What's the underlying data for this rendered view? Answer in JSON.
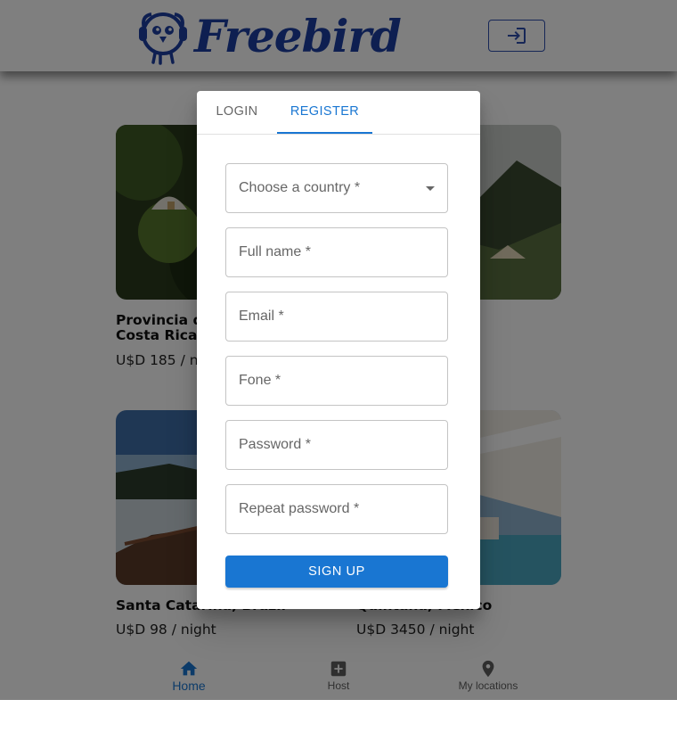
{
  "header": {
    "logo_text": "Freebird",
    "login_icon": "login-icon"
  },
  "listings": [
    {
      "title": "Provincia de Alajuela, Costa Rica",
      "price": "U$D 185 / night"
    },
    {
      "title": "",
      "price": ""
    },
    {
      "title": "Santa Catarina, Brazil",
      "price": "U$D 98 / night"
    },
    {
      "title": "Quintana, Mexico",
      "price": "U$D 3450 / night"
    }
  ],
  "bottom_nav": [
    {
      "label": "Home",
      "icon": "home-icon",
      "active": true
    },
    {
      "label": "Host",
      "icon": "add-box-icon",
      "active": false
    },
    {
      "label": "My locations",
      "icon": "location-pin-icon",
      "active": false
    }
  ],
  "dialog": {
    "tabs": [
      {
        "label": "LOGIN",
        "active": false
      },
      {
        "label": "REGISTER",
        "active": true
      }
    ],
    "fields": {
      "country": "Choose a country *",
      "full_name": "Full name *",
      "email": "Email *",
      "phone": "Fone *",
      "password": "Password *",
      "repeat_password": "Repeat password *"
    },
    "submit_label": "SIGN UP"
  },
  "colors": {
    "primary": "#1976d2",
    "brand": "#1d3fa3",
    "backdrop": "rgba(0,0,0,0.5)"
  }
}
